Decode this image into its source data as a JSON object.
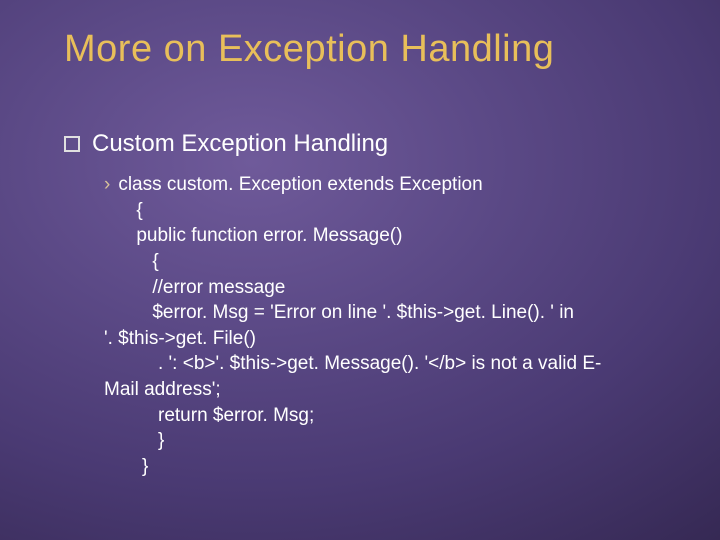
{
  "title": "More on Exception Handling",
  "level1_text": "Custom Exception Handling",
  "code": {
    "l1": "class custom. Exception extends Exception",
    "l2": "{",
    "l3": "public function error. Message()",
    "l4": "{",
    "l5": "//error message",
    "l6": "$error. Msg = 'Error on line '. $this->get. Line(). ' in",
    "l7": "'. $this->get. File()",
    "l8": ". ': <b>'. $this->get. Message(). '</b> is not a valid E-",
    "l9": "Mail address';",
    "l10": "return $error. Msg;",
    "l11": "}",
    "l12": "}"
  }
}
